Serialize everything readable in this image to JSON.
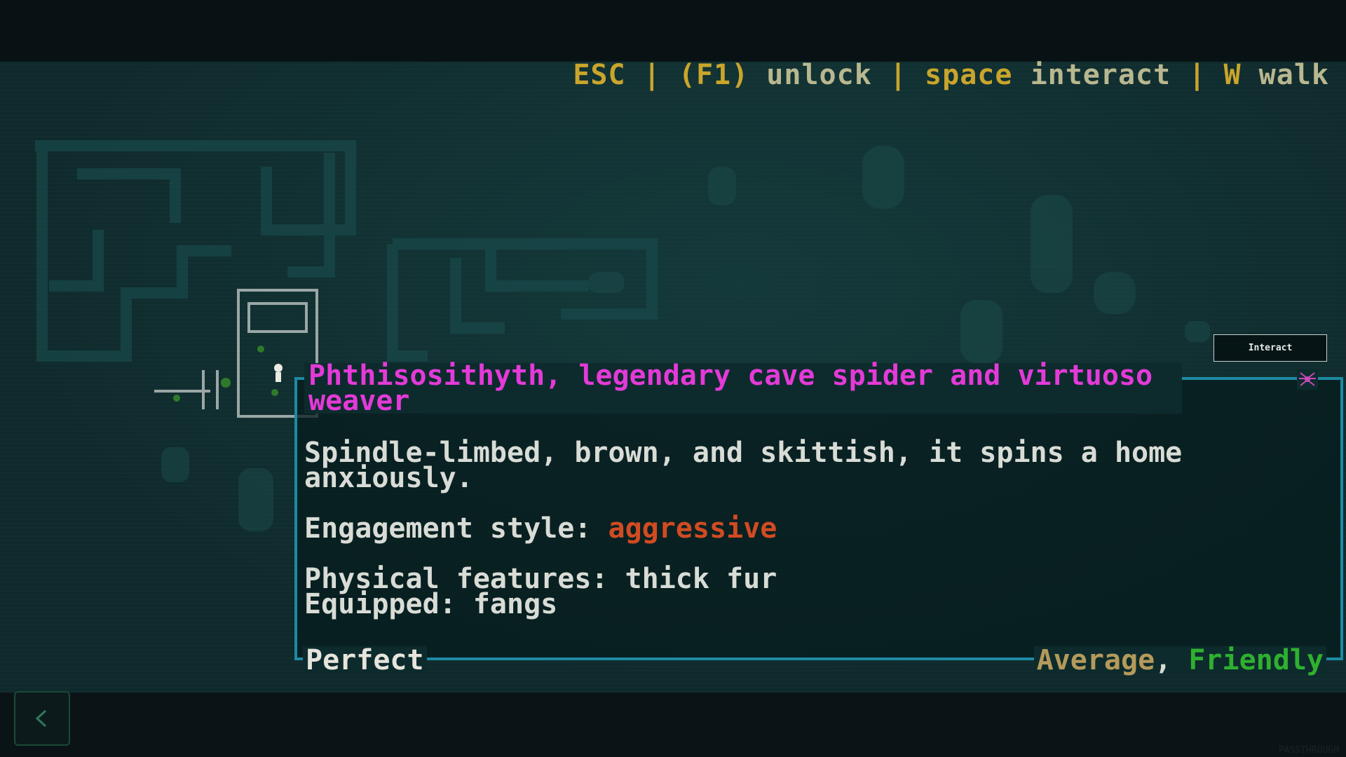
{
  "hotkeys": [
    {
      "key": "ESC",
      "text": ""
    },
    {
      "key": "(F1)",
      "text": "unlock"
    },
    {
      "key": "space",
      "text": "interact"
    },
    {
      "key": "W",
      "text": "walk"
    }
  ],
  "interact_button": {
    "label": "Interact"
  },
  "popup": {
    "title": "Phthisosithyth, legendary cave spider and virtuoso weaver",
    "description": "Spindle-limbed, brown, and skittish, it spins a home anxiously.",
    "engagement_label": "Engagement style:",
    "engagement_value": "aggressive",
    "physical_features": "Physical features: thick fur",
    "equipped": "Equipped: fangs",
    "health_status": "Perfect",
    "difficulty": "Average",
    "separator": ",",
    "attitude": "Friendly",
    "icon": "spider-icon"
  },
  "back_button": {
    "icon": "chevron-left-icon"
  },
  "watermark": "PASSTHROUGH",
  "colors": {
    "background": "#0f2a2c",
    "title": "#e43ad8",
    "hotkey": "#c9a52c",
    "aggressive": "#d24b22",
    "friendly": "#2fb02f",
    "border": "#1d8aa4"
  }
}
